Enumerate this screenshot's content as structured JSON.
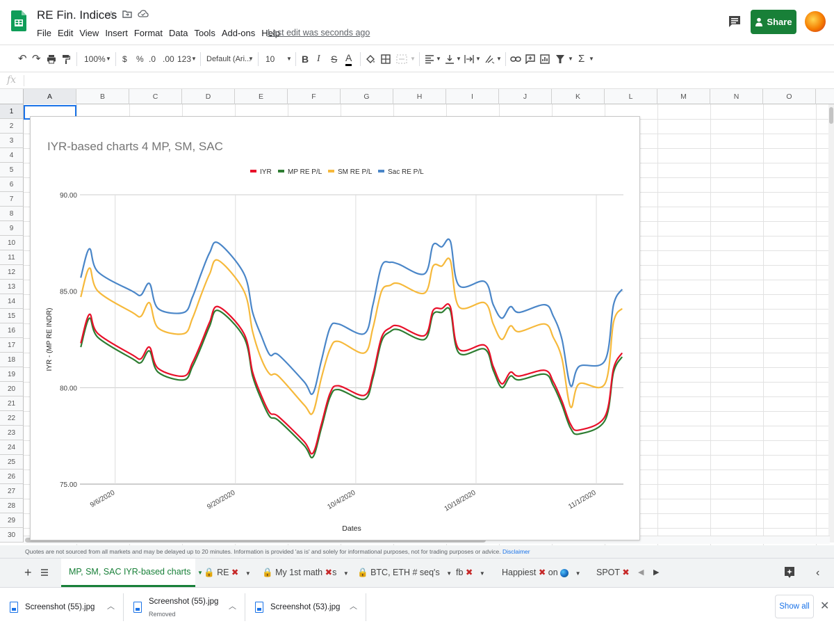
{
  "app": {
    "doc_title": "RE Fin. Indices",
    "last_edit": "Last edit was seconds ago",
    "share_label": "Share",
    "menus": [
      "File",
      "Edit",
      "View",
      "Insert",
      "Format",
      "Data",
      "Tools",
      "Add-ons",
      "Help"
    ]
  },
  "toolbar": {
    "zoom": "100%",
    "currency": "$",
    "percent": "%",
    "decrease_decimal": ".0",
    "increase_decimal": ".00",
    "more_formats": "123",
    "font": "Default (Ari...",
    "font_size": "10",
    "bold": "B",
    "italic": "I",
    "strike": "S",
    "text_color": "A",
    "functions": "Σ"
  },
  "formula_bar": {
    "fx": "fx"
  },
  "grid": {
    "columns": [
      "A",
      "B",
      "C",
      "D",
      "E",
      "F",
      "G",
      "H",
      "I",
      "J",
      "K",
      "L",
      "M",
      "N",
      "O"
    ],
    "rows": [
      "1",
      "2",
      "3",
      "4",
      "5",
      "6",
      "7",
      "8",
      "9",
      "10",
      "11",
      "12",
      "13",
      "14",
      "15",
      "16",
      "17",
      "18",
      "19",
      "20",
      "21",
      "22",
      "23",
      "24",
      "25",
      "26",
      "27",
      "28",
      "29",
      "30"
    ]
  },
  "chart_data": {
    "type": "line",
    "title": "IYR-based charts 4 MP, SM, SAC",
    "xlabel": "Dates",
    "ylabel": "IYR - (MP RE INDR)",
    "ylim": [
      75,
      90
    ],
    "y_ticks": [
      "75.00",
      "80.00",
      "85.00",
      "90.00"
    ],
    "x_ticks": [
      "9/6/2020",
      "9/20/2020",
      "10/4/2020",
      "10/18/2020",
      "11/1/2020"
    ],
    "legend_position": "top",
    "grid": true,
    "x": [
      "9/2/2020",
      "9/3/2020",
      "9/4/2020",
      "9/8/2020",
      "9/9/2020",
      "9/10/2020",
      "9/11/2020",
      "9/14/2020",
      "9/15/2020",
      "9/16/2020",
      "9/17/2020",
      "9/18/2020",
      "9/21/2020",
      "9/22/2020",
      "9/23/2020",
      "9/24/2020",
      "9/25/2020",
      "9/28/2020",
      "9/29/2020",
      "9/30/2020",
      "10/1/2020",
      "10/2/2020",
      "10/5/2020",
      "10/6/2020",
      "10/7/2020",
      "10/8/2020",
      "10/9/2020",
      "10/12/2020",
      "10/13/2020",
      "10/14/2020",
      "10/15/2020",
      "10/16/2020",
      "10/19/2020",
      "10/20/2020",
      "10/21/2020",
      "10/22/2020",
      "10/23/2020",
      "10/26/2020",
      "10/27/2020",
      "10/28/2020",
      "10/29/2020",
      "10/30/2020",
      "11/2/2020",
      "11/3/2020",
      "11/4/2020"
    ],
    "series": [
      {
        "name": "IYR",
        "color": "#e8102a",
        "values": [
          82.3,
          83.8,
          82.8,
          81.7,
          81.5,
          82.1,
          81.0,
          80.6,
          81.3,
          82.3,
          83.4,
          84.2,
          82.8,
          80.8,
          79.6,
          78.7,
          78.5,
          77.2,
          76.6,
          78.1,
          79.7,
          80.1,
          79.6,
          80.7,
          82.6,
          83.1,
          83.2,
          82.7,
          84.0,
          84.1,
          84.2,
          82.0,
          82.2,
          81.1,
          80.2,
          80.8,
          80.6,
          80.9,
          80.3,
          79.3,
          78.1,
          77.8,
          78.5,
          81.0,
          81.8
        ]
      },
      {
        "name": "MP RE P/L",
        "color": "#2e7d32",
        "values": [
          82.1,
          83.6,
          82.6,
          81.5,
          81.3,
          81.9,
          80.8,
          80.4,
          81.1,
          82.1,
          83.2,
          84.0,
          82.6,
          80.6,
          79.4,
          78.5,
          78.3,
          77.0,
          76.4,
          77.9,
          79.5,
          79.9,
          79.4,
          80.5,
          82.4,
          82.9,
          83.0,
          82.5,
          83.8,
          83.9,
          84.0,
          81.8,
          82.0,
          80.9,
          80.0,
          80.6,
          80.4,
          80.7,
          80.1,
          79.1,
          77.9,
          77.6,
          78.3,
          80.8,
          81.6
        ]
      },
      {
        "name": "SM RE P/L",
        "color": "#f6b93b",
        "values": [
          84.7,
          86.2,
          85.0,
          83.9,
          83.7,
          84.4,
          83.1,
          82.8,
          83.6,
          84.8,
          85.9,
          86.6,
          85.0,
          82.9,
          81.5,
          80.7,
          80.6,
          79.1,
          78.7,
          80.5,
          82.0,
          82.4,
          81.8,
          83.1,
          85.0,
          85.3,
          85.4,
          84.9,
          86.3,
          86.3,
          86.6,
          84.2,
          84.4,
          83.3,
          82.5,
          83.2,
          82.9,
          83.3,
          82.6,
          81.5,
          79.0,
          80.2,
          80.2,
          83.4,
          84.1
        ]
      },
      {
        "name": "Sac RE P/L",
        "color": "#4a86c8",
        "values": [
          85.7,
          87.2,
          86.0,
          85.0,
          84.8,
          85.4,
          84.1,
          83.9,
          84.7,
          85.9,
          87.0,
          87.5,
          85.9,
          83.9,
          82.7,
          81.7,
          81.7,
          80.3,
          79.7,
          81.4,
          83.1,
          83.3,
          82.8,
          84.3,
          86.3,
          86.5,
          86.4,
          85.9,
          87.4,
          87.3,
          87.6,
          85.3,
          85.5,
          84.3,
          83.6,
          84.2,
          83.9,
          84.3,
          83.7,
          82.5,
          80.1,
          81.1,
          81.4,
          84.3,
          85.1
        ]
      }
    ]
  },
  "disclaimer": {
    "text": "Quotes are not sourced from all markets and may be delayed up to 20 minutes. Information is provided 'as is' and solely for informational purposes, not for trading purposes or advice.",
    "link": "Disclaimer"
  },
  "tabs": {
    "active": "MP, SM, SAC  IYR-based charts",
    "others": [
      "RE",
      "My 1st math",
      "BTC, ETH # seq's",
      "fb",
      "Happiest",
      "SPOT"
    ],
    "suffix_my_math": "s",
    "suffix_happiest": "on"
  },
  "downloads": {
    "items": [
      {
        "name": "Screenshot (55).jpg",
        "sub": ""
      },
      {
        "name": "Screenshot (55).jpg",
        "sub": "Removed"
      },
      {
        "name": "Screenshot (53).jpg",
        "sub": ""
      }
    ],
    "show_all": "Show all"
  }
}
